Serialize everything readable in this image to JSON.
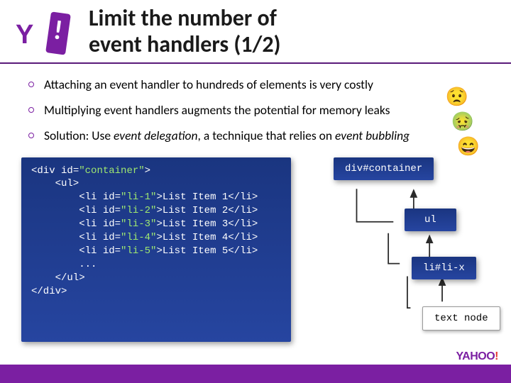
{
  "title_line1": "Limit the number of",
  "title_line2": "event handlers (1/2)",
  "bullets": [
    "Attaching an event handler to hundreds of elements is very costly",
    "Multiplying event handlers augments the potential for memory leaks",
    "Solution: Use event delegation, a technique that relies on event bubbling"
  ],
  "code": {
    "l1a": "<div ",
    "l1b": "id",
    "l1c": "=",
    "l1d": "\"container\"",
    "l1e": ">",
    "l2": "    <ul>",
    "li": [
      {
        "pre": "        <li ",
        "id": "id",
        "eq": "=",
        "val": "\"li-1\"",
        "mid": ">List Item 1</li>"
      },
      {
        "pre": "        <li ",
        "id": "id",
        "eq": "=",
        "val": "\"li-2\"",
        "mid": ">List Item 2</li>"
      },
      {
        "pre": "        <li ",
        "id": "id",
        "eq": "=",
        "val": "\"li-3\"",
        "mid": ">List Item 3</li>"
      },
      {
        "pre": "        <li ",
        "id": "id",
        "eq": "=",
        "val": "\"li-4\"",
        "mid": ">List Item 4</li>"
      },
      {
        "pre": "        <li ",
        "id": "id",
        "eq": "=",
        "val": "\"li-5\"",
        "mid": ">List Item 5</li>"
      }
    ],
    "dots": "        ...",
    "l9": "    </ul>",
    "l10": "</div>"
  },
  "diagram": {
    "b1": "div#container",
    "b2": "ul",
    "b3": "li#li-x",
    "b4": "text node"
  },
  "footer_brand": "YAHOO",
  "footer_bang": "!"
}
